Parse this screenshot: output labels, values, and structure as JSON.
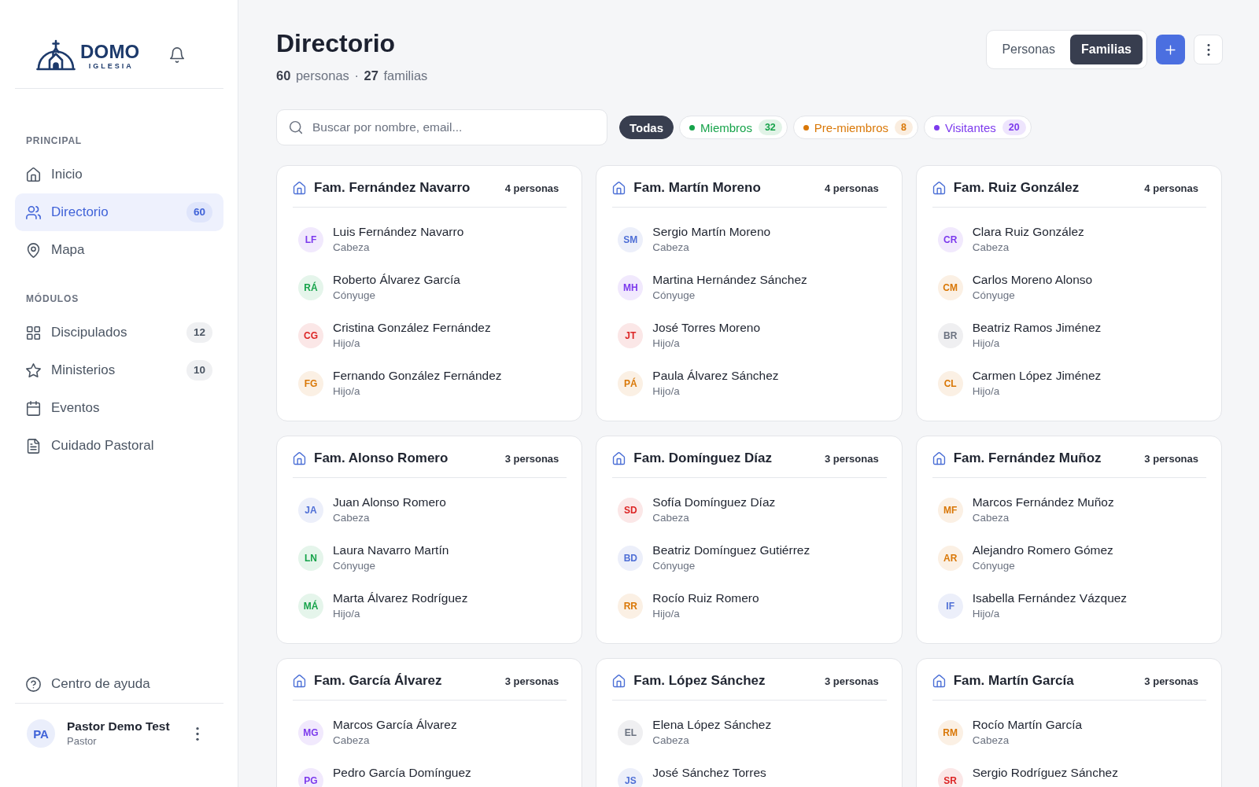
{
  "sidebar": {
    "logo": {
      "wordmark": "DOMO",
      "tagline": "IGLESIA"
    },
    "sections": [
      {
        "label": "PRINCIPAL",
        "items": [
          {
            "label": "Inicio",
            "selected": false
          },
          {
            "label": "Directorio",
            "selected": true,
            "count": "60"
          },
          {
            "label": "Mapa",
            "selected": false
          }
        ]
      },
      {
        "label": "MÓDULOS",
        "items": [
          {
            "label": "Discipulados",
            "selected": false,
            "count": "12"
          },
          {
            "label": "Ministerios",
            "selected": false,
            "count": "10"
          },
          {
            "label": "Eventos",
            "selected": false
          },
          {
            "label": "Cuidado Pastoral",
            "selected": false
          }
        ]
      }
    ],
    "help": {
      "label": "Centro de ayuda"
    },
    "user": {
      "initials": "PA",
      "name": "Pastor Demo Test",
      "role": "Pastor"
    }
  },
  "header": {
    "title": "Directorio",
    "summary": "**60** personas · **27** familias",
    "view_toggle": [
      {
        "label": "Personas",
        "selected": false
      },
      {
        "label": "Familias",
        "selected": true
      }
    ]
  },
  "search": {
    "placeholder": "Buscar por nombre, email..."
  },
  "filters": [
    {
      "label": "Todas",
      "selected": true
    },
    {
      "label": "Miembros",
      "count": "32",
      "color": "#16a34a",
      "selected": false
    },
    {
      "label": "Pre-miembros",
      "count": "8",
      "color": "#d97706",
      "selected": false
    },
    {
      "label": "Visitantes",
      "count": "20",
      "color": "#7c3aed",
      "selected": false
    }
  ],
  "families": [
    {
      "name": "Fam. Fernández Navarro",
      "count": "4 personas",
      "members": [
        {
          "initials": "LF",
          "name": "Luis Fernández Navarro",
          "role": "Cabeza",
          "color": "#7c3aed"
        },
        {
          "initials": "RÁ",
          "name": "Roberto Álvarez García",
          "role": "Cónyuge",
          "color": "#16a34a"
        },
        {
          "initials": "CG",
          "name": "Cristina González Fernández",
          "role": "Hijo/a",
          "color": "#dc2626"
        },
        {
          "initials": "FG",
          "name": "Fernando González Fernández",
          "role": "Hijo/a",
          "color": "#d97706"
        }
      ]
    },
    {
      "name": "Fam. Martín Moreno",
      "count": "4 personas",
      "members": [
        {
          "initials": "SM",
          "name": "Sergio Martín Moreno",
          "role": "Cabeza",
          "color": "#4f6fd6"
        },
        {
          "initials": "MH",
          "name": "Martina Hernández Sánchez",
          "role": "Cónyuge",
          "color": "#7c3aed"
        },
        {
          "initials": "JT",
          "name": "José Torres Moreno",
          "role": "Hijo/a",
          "color": "#dc2626"
        },
        {
          "initials": "PÁ",
          "name": "Paula Álvarez Sánchez",
          "role": "Hijo/a",
          "color": "#d97706"
        }
      ]
    },
    {
      "name": "Fam. Ruiz González",
      "count": "4 personas",
      "members": [
        {
          "initials": "CR",
          "name": "Clara Ruiz González",
          "role": "Cabeza",
          "color": "#7c3aed"
        },
        {
          "initials": "CM",
          "name": "Carlos Moreno Alonso",
          "role": "Cónyuge",
          "color": "#d97706"
        },
        {
          "initials": "BR",
          "name": "Beatriz Ramos Jiménez",
          "role": "Hijo/a",
          "color": "#6b7280"
        },
        {
          "initials": "CL",
          "name": "Carmen López Jiménez",
          "role": "Hijo/a",
          "color": "#d97706"
        }
      ]
    },
    {
      "name": "Fam. Alonso Romero",
      "count": "3 personas",
      "members": [
        {
          "initials": "JA",
          "name": "Juan Alonso Romero",
          "role": "Cabeza",
          "color": "#4f6fd6"
        },
        {
          "initials": "LN",
          "name": "Laura Navarro Martín",
          "role": "Cónyuge",
          "color": "#16a34a"
        },
        {
          "initials": "MÁ",
          "name": "Marta Álvarez Rodríguez",
          "role": "Hijo/a",
          "color": "#16a34a"
        }
      ]
    },
    {
      "name": "Fam. Domínguez Díaz",
      "count": "3 personas",
      "members": [
        {
          "initials": "SD",
          "name": "Sofía Domínguez Díaz",
          "role": "Cabeza",
          "color": "#dc2626"
        },
        {
          "initials": "BD",
          "name": "Beatriz Domínguez Gutiérrez",
          "role": "Cónyuge",
          "color": "#4f6fd6"
        },
        {
          "initials": "RR",
          "name": "Rocío Ruiz Romero",
          "role": "Hijo/a",
          "color": "#d97706"
        }
      ]
    },
    {
      "name": "Fam. Fernández Muñoz",
      "count": "3 personas",
      "members": [
        {
          "initials": "MF",
          "name": "Marcos Fernández Muñoz",
          "role": "Cabeza",
          "color": "#d97706"
        },
        {
          "initials": "AR",
          "name": "Alejandro Romero Gómez",
          "role": "Cónyuge",
          "color": "#d97706"
        },
        {
          "initials": "IF",
          "name": "Isabella Fernández Vázquez",
          "role": "Hijo/a",
          "color": "#4f6fd6"
        }
      ]
    },
    {
      "name": "Fam. García Álvarez",
      "count": "3 personas",
      "members": [
        {
          "initials": "MG",
          "name": "Marcos García Álvarez",
          "role": "Cabeza",
          "color": "#7c3aed"
        },
        {
          "initials": "PG",
          "name": "Pedro García Domínguez",
          "color": "#7c3aed"
        }
      ]
    },
    {
      "name": "Fam. López Sánchez",
      "count": "3 personas",
      "members": [
        {
          "initials": "EL",
          "name": "Elena López Sánchez",
          "role": "Cabeza",
          "color": "#6b7280"
        },
        {
          "initials": "JS",
          "name": "José Sánchez Torres",
          "color": "#4f6fd6"
        }
      ]
    },
    {
      "name": "Fam. Martín García",
      "count": "3 personas",
      "members": [
        {
          "initials": "RM",
          "name": "Rocío Martín García",
          "role": "Cabeza",
          "color": "#d97706"
        },
        {
          "initials": "SR",
          "name": "Sergio Rodríguez Sánchez",
          "color": "#dc2626"
        }
      ]
    }
  ]
}
